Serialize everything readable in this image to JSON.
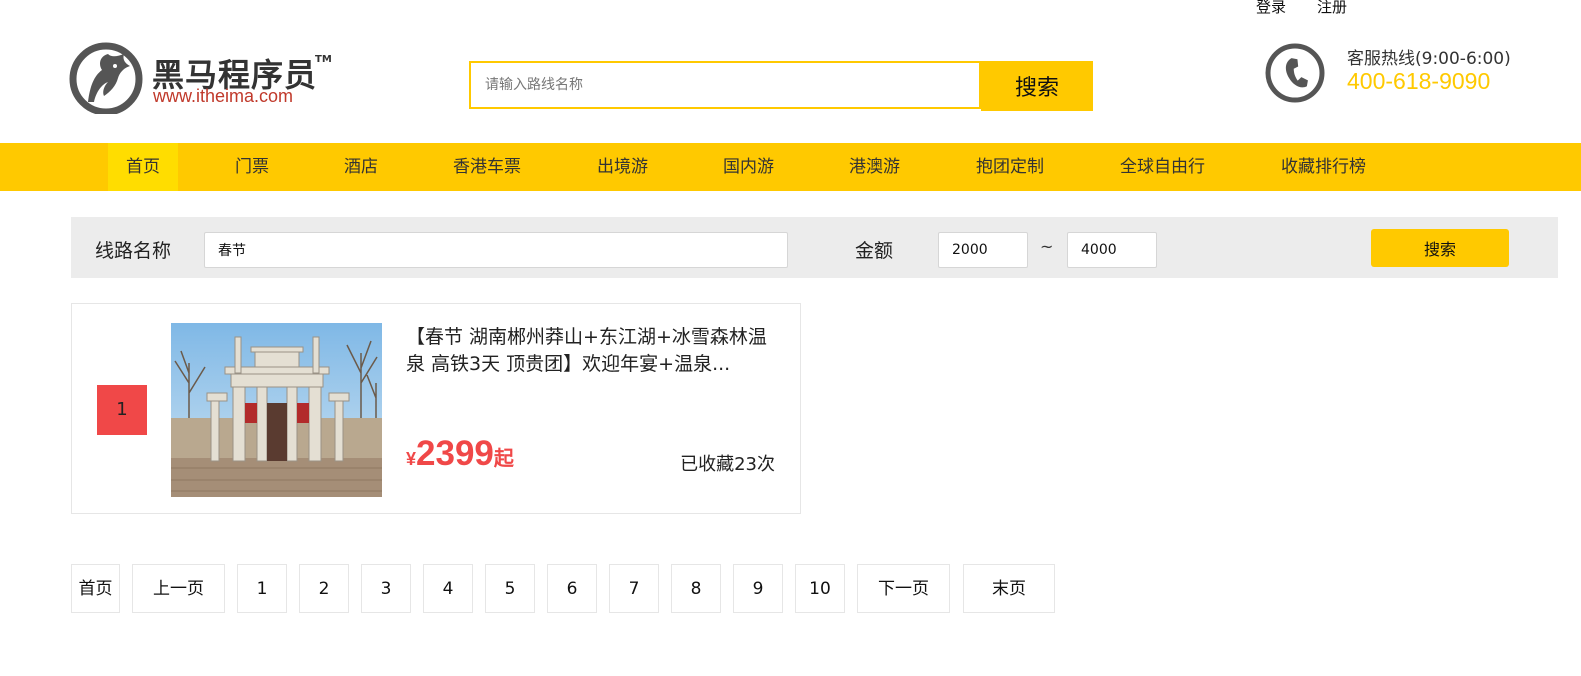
{
  "top_links": {
    "login": "登录",
    "register": "注册"
  },
  "logo": {
    "brand_cn": "黑马程序员",
    "tm": "TM",
    "url_text": "www.itheima.com"
  },
  "search": {
    "placeholder": "请输入路线名称",
    "button": "搜索"
  },
  "hotline": {
    "label": "客服热线(9:00-6:00)",
    "number": "400-618-9090"
  },
  "nav": {
    "items": [
      "首页",
      "门票",
      "酒店",
      "香港车票",
      "出境游",
      "国内游",
      "港澳游",
      "抱团定制",
      "全球自由行",
      "收藏排行榜"
    ],
    "active_index": 0
  },
  "filter": {
    "route_label": "线路名称",
    "route_value": "春节",
    "amount_label": "金额",
    "min_value": "2000",
    "tilde": "~",
    "max_value": "4000",
    "button": "搜索"
  },
  "results": [
    {
      "rank": "1",
      "title": "【春节 湖南郴州莽山+东江湖+冰雪森林温泉 高铁3天 顶贵团】欢迎年宴+温泉...",
      "currency": "¥",
      "price": "2399",
      "price_suffix": "起",
      "favorites": "已收藏23次"
    }
  ],
  "pagination": {
    "first": "首页",
    "prev": "上一页",
    "pages": [
      "1",
      "2",
      "3",
      "4",
      "5",
      "6",
      "7",
      "8",
      "9",
      "10"
    ],
    "next": "下一页",
    "last": "末页"
  },
  "colors": {
    "accent": "#ffc900",
    "rank_bg": "#f04848",
    "price": "#f04848",
    "filter_bg": "#ececec"
  }
}
